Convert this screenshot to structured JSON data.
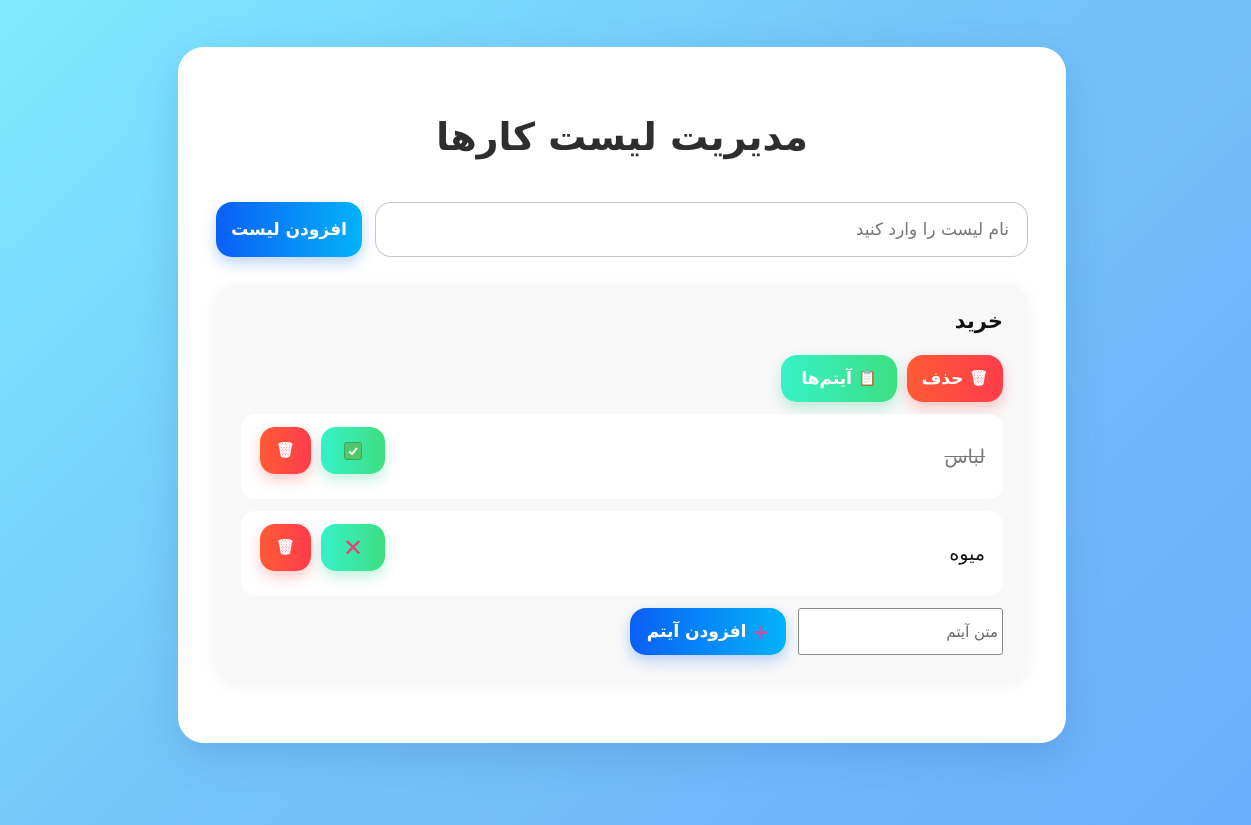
{
  "page": {
    "title": "مدیریت لیست کارها",
    "list_input_placeholder": "نام لیست را وارد کنید",
    "add_list_label": "افزودن لیست"
  },
  "lists": [
    {
      "name": "خرید",
      "delete_label": "حذف",
      "items_label": "آیتم‌ها",
      "items": [
        {
          "text": "لباس",
          "done": true,
          "toggle_icon": "✅"
        },
        {
          "text": "میوه",
          "done": false,
          "toggle_icon": "✕"
        }
      ],
      "item_input_placeholder": "متن آیتم",
      "add_item_label": "افزودن آیتم"
    }
  ],
  "icons": {
    "delete": "🗑",
    "items": "📋",
    "plus": "+",
    "check": "✓",
    "x": "✕"
  },
  "colors": {
    "accent_blue": "#0a5ff6",
    "danger_red": "#ff3c4b",
    "success_green": "#3dde82"
  }
}
